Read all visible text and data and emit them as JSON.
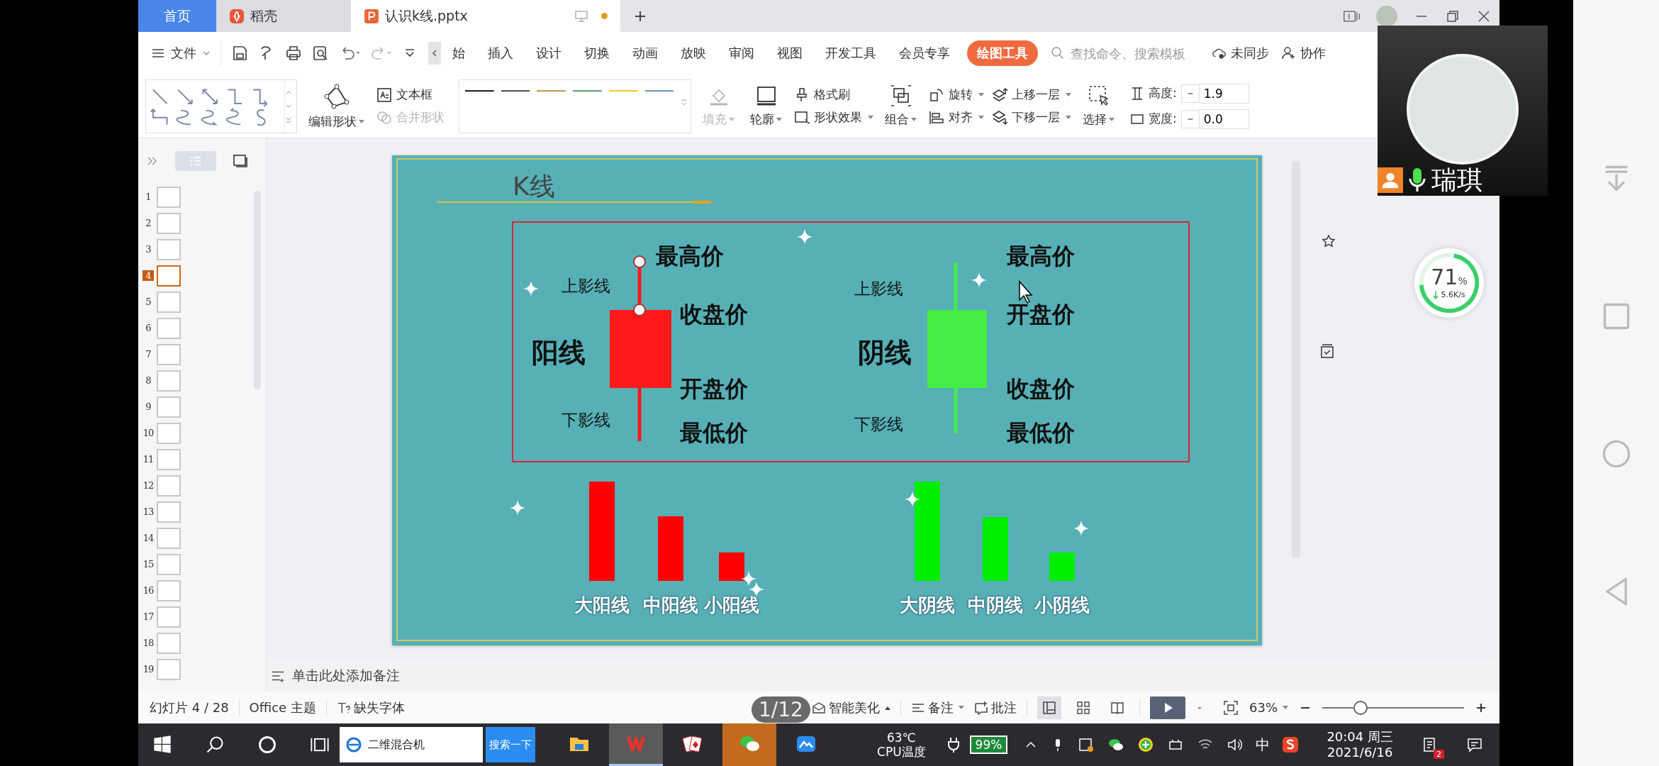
{
  "tabs": [
    {
      "kind": "home",
      "label": "首页",
      "selected": false
    },
    {
      "kind": "app",
      "label": "稻壳",
      "selected": false
    },
    {
      "kind": "doc",
      "label": "认识k线.pptx",
      "selected": true,
      "unsaved": true
    }
  ],
  "menu": {
    "file": "文件",
    "items": [
      {
        "label": "始",
        "selected": false
      },
      {
        "label": "插入",
        "selected": false
      },
      {
        "label": "设计",
        "selected": false
      },
      {
        "label": "切换",
        "selected": false
      },
      {
        "label": "动画",
        "selected": false
      },
      {
        "label": "放映",
        "selected": false
      },
      {
        "label": "审阅",
        "selected": false
      },
      {
        "label": "视图",
        "selected": false
      },
      {
        "label": "开发工具",
        "selected": false
      },
      {
        "label": "会员专享",
        "selected": false
      },
      {
        "label": "绘图工具",
        "selected": true
      }
    ],
    "search": {
      "placeholder": "查找命令、搜索模板"
    },
    "sync": "未同步",
    "collab": "协作"
  },
  "ribbon": {
    "edit_shape": "编辑形状",
    "text_box": "文本框",
    "merge_shape": {
      "label": "合并形状",
      "disabled": true
    },
    "line_styles": [
      {
        "color": "#111111"
      },
      {
        "color": "#444444"
      },
      {
        "color": "#b8923a"
      },
      {
        "color": "#4f9a6e"
      },
      {
        "color": "#e8c82a"
      },
      {
        "color": "#6a8fa8"
      }
    ],
    "fill": {
      "label": "填充",
      "disabled": true
    },
    "outline": "轮廓",
    "format_painter": "格式刷",
    "shape_effect": "形状效果",
    "group": "组合",
    "rotate": "旋转",
    "align": "对齐",
    "bring_forward": "上移一层",
    "send_backward": "下移一层",
    "select": "选择",
    "height": {
      "label": "高度:",
      "value": "1.9"
    },
    "width": {
      "label": "宽度:",
      "value": "0.0"
    }
  },
  "slides": [
    {
      "number": "1",
      "selected": false
    },
    {
      "number": "2",
      "selected": false
    },
    {
      "number": "3",
      "selected": false
    },
    {
      "number": "4",
      "selected": true
    },
    {
      "number": "5",
      "selected": false
    },
    {
      "number": "6",
      "selected": false
    },
    {
      "number": "7",
      "selected": false
    },
    {
      "number": "8",
      "selected": false
    },
    {
      "number": "9",
      "selected": false
    },
    {
      "number": "10",
      "selected": false
    },
    {
      "number": "11",
      "selected": false
    },
    {
      "number": "12",
      "selected": false
    },
    {
      "number": "13",
      "selected": false
    },
    {
      "number": "14",
      "selected": false
    },
    {
      "number": "15",
      "selected": false
    },
    {
      "number": "16",
      "selected": false
    },
    {
      "number": "17",
      "selected": false
    },
    {
      "number": "18",
      "selected": false
    },
    {
      "number": "19",
      "selected": false
    }
  ],
  "slide": {
    "title": "K线",
    "candles": [
      {
        "kind": "yang",
        "name": "阳线",
        "color": "#ff1a1a",
        "upper_shadow": "上影线",
        "lower_shadow": "下影线",
        "labels": [
          "最高价",
          "收盘价",
          "开盘价",
          "最低价"
        ]
      },
      {
        "kind": "yin",
        "name": "阴线",
        "color": "#44ee44",
        "upper_shadow": "上影线",
        "lower_shadow": "下影线",
        "labels": [
          "最高价",
          "开盘价",
          "收盘价",
          "最低价"
        ]
      }
    ],
    "bar_groups": [
      {
        "color": "#ff0000",
        "bars": [
          {
            "label": "大阳线"
          },
          {
            "label": "中阳线"
          },
          {
            "label": "小阳线"
          }
        ]
      },
      {
        "color": "#00ee00",
        "bars": [
          {
            "label": "大阴线"
          },
          {
            "label": "中阴线"
          },
          {
            "label": "小阴线"
          }
        ]
      }
    ]
  },
  "notes": {
    "hint": "单击此处添加备注"
  },
  "status_bar": {
    "slide": "幻灯片 4 / 28",
    "theme": "Office 主题",
    "missing_fonts": "缺失字体",
    "beautify": "智能美化",
    "notes": "备注",
    "comments": "批注",
    "views": [
      {
        "kind": "normal",
        "selected": true
      },
      {
        "kind": "sorter",
        "selected": false
      },
      {
        "kind": "reading",
        "selected": false
      }
    ],
    "zoom": "63%",
    "zoom_slider": {
      "level": 0.26
    }
  },
  "page_indicator": "1/12",
  "taskbar": {
    "search": {
      "value": "二维混合机"
    },
    "search_button": "搜索一下",
    "apps": [
      {
        "kind": "explorer",
        "active": false,
        "attention": false
      },
      {
        "kind": "wps",
        "active": true,
        "attention": false
      },
      {
        "kind": "cards",
        "active": false,
        "attention": false
      },
      {
        "kind": "wechat",
        "active": false,
        "attention": true
      },
      {
        "kind": "cloud",
        "active": false,
        "attention": false
      }
    ],
    "cpu_temp": "63℃",
    "cpu_label": "CPU温度",
    "battery": "99%",
    "ime": "中",
    "time": "20:04 周三",
    "date": "2021/6/16",
    "notifications": "2"
  },
  "video_call": {
    "name": "瑞琪"
  },
  "net_meter": {
    "level": 0.71,
    "value": "71",
    "unit": "%",
    "speed": "5.6K/s"
  }
}
